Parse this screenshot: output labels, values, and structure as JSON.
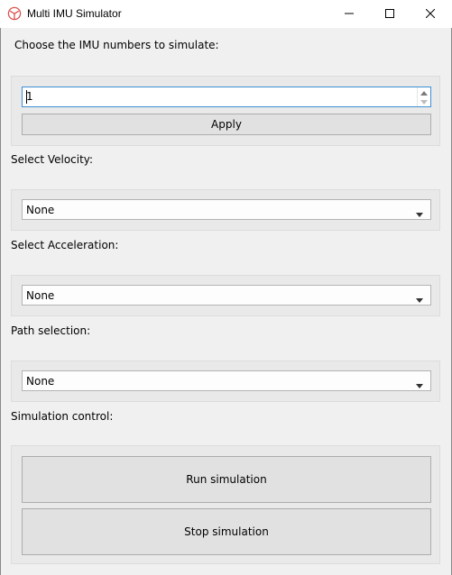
{
  "window": {
    "title": "Multi IMU Simulator",
    "icon": "app-logo-icon",
    "controls": [
      "minimize-icon",
      "maximize-icon",
      "close-icon"
    ]
  },
  "imu": {
    "label": "Choose the IMU numbers to simulate:",
    "value": "1",
    "apply_label": "Apply"
  },
  "velocity": {
    "label": "Select Velocity:",
    "selected": "None"
  },
  "acceleration": {
    "label": "Select Acceleration:",
    "selected": "None"
  },
  "path": {
    "label": "Path selection:",
    "selected": "None"
  },
  "simulation": {
    "label": "Simulation control:",
    "run_label": "Run simulation",
    "stop_label": "Stop simulation"
  },
  "colors": {
    "background": "#f0f0f0",
    "group": "#e9e9e9",
    "button": "#e1e1e1",
    "focus": "#3c8fd6",
    "logo": "#d9534f"
  }
}
